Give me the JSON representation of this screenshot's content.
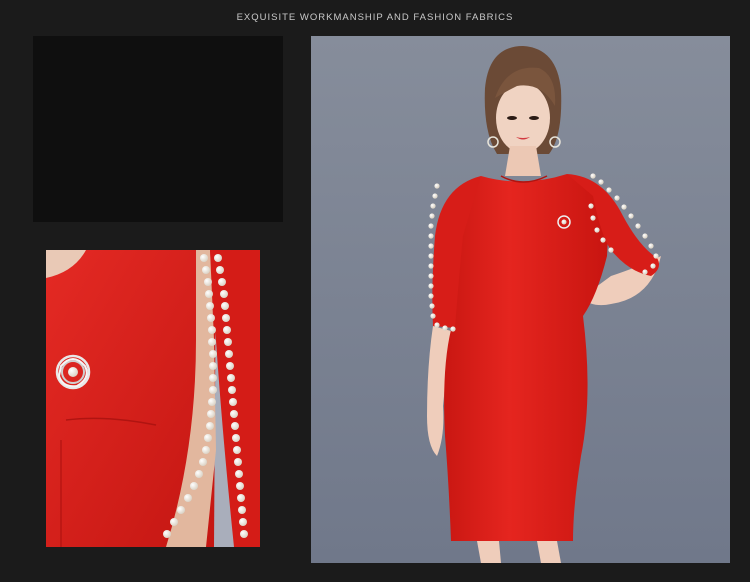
{
  "header": {
    "title": "EXQUISITE WORKMANSHIP AND FASHION FABRICS"
  },
  "colors": {
    "page_background": "#1b1b1b",
    "dress_red": "#e0201c",
    "studio_backdrop": "#7f8695",
    "pearl": "#f4efe6"
  },
  "images": {
    "detail_photo": "dress-sleeve-closeup-with-pearl-trim-and-flower-brooch",
    "main_photo": "model-wearing-red-half-sleeve-pearl-trim-dress"
  }
}
